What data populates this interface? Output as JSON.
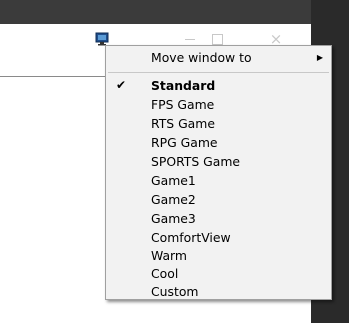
{
  "titlebar": {
    "minimize_glyph": "",
    "maximize_glyph": "",
    "close_glyph": "×"
  },
  "tray_icon": "monitor-icon",
  "menu": {
    "submenu": {
      "label": "Move window to",
      "arrow": "▶"
    },
    "items": [
      {
        "label": "Standard",
        "checked": true,
        "check_glyph": "✔"
      },
      {
        "label": "FPS Game"
      },
      {
        "label": "RTS Game"
      },
      {
        "label": "RPG Game"
      },
      {
        "label": "SPORTS Game"
      },
      {
        "label": "Game1"
      },
      {
        "label": "Game2"
      },
      {
        "label": "Game3"
      },
      {
        "label": "ComfortView"
      },
      {
        "label": "Warm"
      },
      {
        "label": "Cool"
      },
      {
        "label": "Custom"
      }
    ]
  }
}
